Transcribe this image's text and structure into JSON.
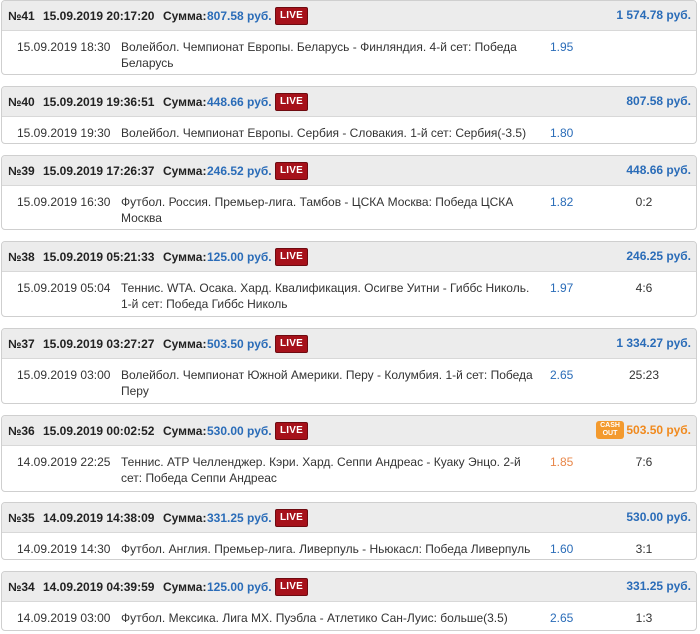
{
  "labels": {
    "sum_label": "Сумма:",
    "live_badge": "LIVE",
    "cashout_line1": "CASH",
    "cashout_line2": "OUT"
  },
  "colors": {
    "header_bg": "#ececec",
    "accent_blue": "#2a6cb8",
    "live_red": "#a6111a",
    "cashout_orange": "#f39a2e"
  },
  "bets": [
    {
      "number": "№41",
      "datetime": "15.09.2019 20:17:20",
      "amount": "807.58 руб.",
      "payout": "1 574.78 руб.",
      "payout_status": "win",
      "cashout": false,
      "row": {
        "date": "15.09.2019 18:30",
        "event": "Волейбол. Чемпионат Европы. Беларусь - Финляндия. 4-й сет: Победа Беларусь",
        "odds": "1.95",
        "score": ""
      }
    },
    {
      "number": "№40",
      "datetime": "15.09.2019 19:36:51",
      "amount": "448.66 руб.",
      "payout": "807.58 руб.",
      "payout_status": "win",
      "cashout": false,
      "row": {
        "date": "15.09.2019 19:30",
        "event": "Волейбол. Чемпионат Европы. Сербия - Словакия. 1-й сет: Сербия(-3.5)",
        "odds": "1.80",
        "score": ""
      }
    },
    {
      "number": "№39",
      "datetime": "15.09.2019 17:26:37",
      "amount": "246.52 руб.",
      "payout": "448.66 руб.",
      "payout_status": "win",
      "cashout": false,
      "row": {
        "date": "15.09.2019 16:30",
        "event": "Футбол. Россия. Премьер-лига. Тамбов - ЦСКА Москва: Победа ЦСКА Москва",
        "odds": "1.82",
        "score": "0:2"
      }
    },
    {
      "number": "№38",
      "datetime": "15.09.2019 05:21:33",
      "amount": "125.00 руб.",
      "payout": "246.25 руб.",
      "payout_status": "win",
      "cashout": false,
      "row": {
        "date": "15.09.2019 05:04",
        "event": "Теннис. WTA. Осака. Хард. Квалификация. Осигве Уитни - Гиббс Николь. 1-й сет: Победа Гиббс Николь",
        "odds": "1.97",
        "score": "4:6"
      }
    },
    {
      "number": "№37",
      "datetime": "15.09.2019 03:27:27",
      "amount": "503.50 руб.",
      "payout": "1 334.27 руб.",
      "payout_status": "win",
      "cashout": false,
      "row": {
        "date": "15.09.2019 03:00",
        "event": "Волейбол. Чемпионат Южной Америки. Перу - Колумбия. 1-й сет: Победа Перу",
        "odds": "2.65",
        "score": "25:23"
      }
    },
    {
      "number": "№36",
      "datetime": "15.09.2019 00:02:52",
      "amount": "530.00 руб.",
      "payout": "503.50 руб.",
      "payout_status": "cashout",
      "cashout": true,
      "row": {
        "date": "14.09.2019 22:25",
        "event": "Теннис. ATP Челленджер. Кэри. Хард. Сеппи Андреас - Куаку Энцо. 2-й сет: Победа Сеппи Андреас",
        "odds": "1.85",
        "score": "7:6"
      }
    },
    {
      "number": "№35",
      "datetime": "14.09.2019 14:38:09",
      "amount": "331.25 руб.",
      "payout": "530.00 руб.",
      "payout_status": "win",
      "cashout": false,
      "row": {
        "date": "14.09.2019 14:30",
        "event": "Футбол. Англия. Премьер-лига. Ливерпуль - Ньюкасл: Победа Ливерпуль",
        "odds": "1.60",
        "score": "3:1"
      }
    },
    {
      "number": "№34",
      "datetime": "14.09.2019 04:39:59",
      "amount": "125.00 руб.",
      "payout": "331.25 руб.",
      "payout_status": "win",
      "cashout": false,
      "row": {
        "date": "14.09.2019 03:00",
        "event": "Футбол. Мексика. Лига MX. Пуэбла - Атлетико Сан-Луис: больше(3.5)",
        "odds": "2.65",
        "score": "1:3"
      }
    }
  ]
}
